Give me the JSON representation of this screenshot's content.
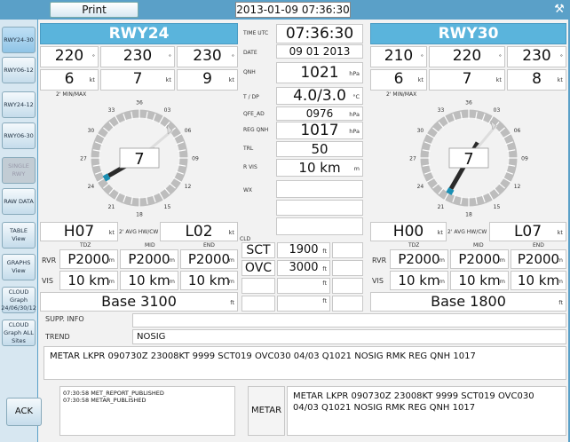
{
  "toolbar": {
    "print_label": "Print",
    "datetime": "2013-01-09 07:36:30",
    "tool_icon": "wrench-icon"
  },
  "sidebar": {
    "items": [
      {
        "label": "RWY24-30",
        "state": "active"
      },
      {
        "label": "RWY06-12",
        "state": "normal"
      },
      {
        "label": "RWY24-12",
        "state": "normal"
      },
      {
        "label": "RWY06-30",
        "state": "normal"
      },
      {
        "label": "SINGLE RWY",
        "state": "disabled"
      },
      {
        "label": "RAW DATA",
        "state": "normal"
      },
      {
        "label": "TABLE View",
        "state": "normal"
      },
      {
        "label": "GRAPHS View",
        "state": "normal"
      },
      {
        "label": "CLOUD Graph 24/06/30/12",
        "state": "normal"
      },
      {
        "label": "CLOUD Graph ALL Sites",
        "state": "normal"
      }
    ]
  },
  "rwy_left": {
    "title": "RWY24",
    "wind_dir": [
      "220",
      "230",
      "230"
    ],
    "wind_speed": [
      "6",
      "7",
      "9"
    ],
    "deg_unit": "°",
    "kt_unit": "kt",
    "minmax_label": "2' MIN/MAX",
    "dial_value": "7",
    "dial_ticks": [
      "33",
      "36",
      "03",
      "06",
      "30",
      "09",
      "27",
      "12",
      "24",
      "15",
      "21",
      "18"
    ],
    "head": "H07",
    "cross": "L02",
    "avg_label": "2' AVG HW/CW",
    "hw_unit": "kt",
    "rvr_label": "RVR",
    "vis_label": "VIS",
    "col_labels": [
      "TDZ",
      "MID",
      "END"
    ],
    "rvr": [
      "P2000",
      "P2000",
      "P2000"
    ],
    "vis": [
      "10 km",
      "10 km",
      "10 km"
    ],
    "m_unit": "m",
    "base": "Base 3100",
    "ft_unit": "ft"
  },
  "rwy_right": {
    "title": "RWY30",
    "wind_dir": [
      "210",
      "220",
      "230"
    ],
    "wind_speed": [
      "6",
      "7",
      "8"
    ],
    "deg_unit": "°",
    "kt_unit": "kt",
    "minmax_label": "2' MIN/MAX",
    "dial_value": "7",
    "dial_ticks": [
      "33",
      "36",
      "03",
      "06",
      "30",
      "09",
      "27",
      "12",
      "24",
      "15",
      "21",
      "18"
    ],
    "head": "H00",
    "cross": "L07",
    "avg_label": "2' AVG HW/CW",
    "hw_unit": "kt",
    "rvr_label": "RVR",
    "vis_label": "VIS",
    "col_labels": [
      "TDZ",
      "MID",
      "END"
    ],
    "rvr": [
      "P2000",
      "P2000",
      "P2000"
    ],
    "vis": [
      "10 km",
      "10 km",
      "10 km"
    ],
    "m_unit": "m",
    "base": "Base 1800",
    "ft_unit": "ft"
  },
  "center": {
    "time_label": "TIME UTC",
    "time": "07:36:30",
    "date_label": "DATE",
    "date": "09 01 2013",
    "qnh_label": "QNH",
    "qnh": "1021",
    "hpa_unit": "hPa",
    "tdp_label": "T / DP",
    "tdp": "4.0/3.0",
    "c_unit": "°C",
    "qfe_label": "QFE_AD",
    "qfe": "0976",
    "regqnh_label": "REG QNH",
    "regqnh": "1017",
    "trl_label": "TRL",
    "trl": "50",
    "rvis_label": "R VIS",
    "rvis": "10 km",
    "rvis_unit": "m",
    "wx_label": "WX",
    "cld_label": "CLD",
    "clouds": [
      {
        "type": "SCT",
        "height": "1900"
      },
      {
        "type": "OVC",
        "height": "3000"
      }
    ],
    "ft_unit": "ft"
  },
  "info": {
    "supp_label": "SUPP. INFO",
    "trend_label": "TREND",
    "trend": "NOSIG",
    "metar_text": "METAR LKPR 090730Z 23008KT 9999 SCT019 OVC030 04/03 Q1021 NOSIG RMK REG QNH 1017"
  },
  "bottom": {
    "ack_label": "ACK",
    "log": [
      "07:30:58 MET_REPORT_PUBLISHED",
      "07:30:58 METAR_PUBLISHED"
    ],
    "metar_label": "METAR",
    "metar_text": "METAR LKPR 090730Z 23008KT 9999 SCT019 OVC030 04/03 Q1021 NOSIG RMK REG QNH 1017"
  }
}
